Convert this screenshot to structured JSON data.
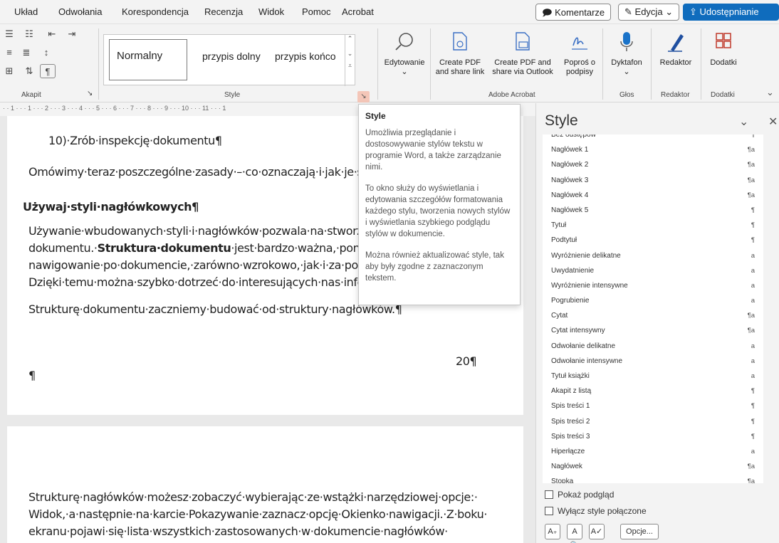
{
  "menu": {
    "items": [
      "Układ",
      "Odwołania",
      "Korespondencja",
      "Recenzja",
      "Widok",
      "Pomoc",
      "Acrobat"
    ],
    "comments_label": "Komentarze",
    "edit_label": "Edycja",
    "share_label": "Udostępnianie"
  },
  "ribbon": {
    "paragraph_group": "Akapit",
    "styles_group": "Style",
    "gallery": [
      "Normalny",
      "przypis dolny",
      "przypis końco"
    ],
    "editing_label": "Edytowanie",
    "acrobat": {
      "create_pdf": [
        "Create PDF",
        "and share link"
      ],
      "create_pdf_outlook": [
        "Create PDF and",
        "share via Outlook"
      ],
      "request_sign": [
        "Poproś o",
        "podpisy"
      ],
      "group": "Adobe Acrobat"
    },
    "dictate_label": "Dyktafon",
    "voice_group": "Głos",
    "editor_label": "Redaktor",
    "editor_group": "Redaktor",
    "addins_label": "Dodatki",
    "addins_group": "Dodatki"
  },
  "ruler": "· · 1 · · · 1 · · · 2 · · · 3 · · · 4 · · · 5 · · · 6 · · · 7 · · · 8 · · · 9 · · · 10 · · · 11 · · · 1",
  "document": {
    "line1": "10)·Zrób·inspekcję·dokumentu¶",
    "line2": "Omówimy·teraz·poszczególne·zasady·–·co·oznaczają·i·jak·je·spe",
    "heading": "Używaj·styli·nagłówkowych¶",
    "para1_l1": "Używanie·wbudowanych·styli·i·nagłówków·pozwala·na·stworzen",
    "para1_l2_pre": "dokumentu.·",
    "para1_l2_bold": "Struktura·dokumentu",
    "para1_l2_post": "·jest·bardzo·ważna,·poniew",
    "para1_l3": "nawigowanie·po·dokumencie,·zarówno·wzrokowo,·jak·i·za·pomo",
    "para1_l4": "Dzięki·temu·można·szybko·dotrzeć·do·interesujących·nas·inform",
    "para2": "Strukturę·dokumentu·zaczniemy·budować·od·struktury·nagłówków.¶",
    "page_number": "20¶",
    "empty_para": "¶",
    "page2_l1": "Strukturę·nagłówków·możesz·zobaczyć·wybierając·ze·wstążki·narzędziowej·opcje:·",
    "page2_l2": "Widok,·a·następnie·na·karcie·Pokazywanie·zaznacz·opcję·Okienko·nawigacji.·Z·boku·",
    "page2_l3": "ekranu·pojawi·się·lista·wszystkich·zastosowanych·w·dokumencie·nagłówków·"
  },
  "tooltip": {
    "title": "Style",
    "p1": "Umożliwia przeglądanie i dostosowywanie stylów tekstu w programie Word, a także zarządzanie nimi.",
    "p2": "To okno służy do wyświetlania i edytowania szczegółów formatowania każdego stylu, tworzenia nowych stylów i wyświetlania szybkiego podglądu stylów w dokumencie.",
    "p3": "Można również aktualizować style, tak aby były zgodne z zaznaczonym tekstem."
  },
  "styles_pane": {
    "title": "Style",
    "items": [
      {
        "name": "Bez odstępów",
        "mark": "¶"
      },
      {
        "name": "Nagłówek 1",
        "mark": "¶a"
      },
      {
        "name": "Nagłówek 2",
        "mark": "¶a"
      },
      {
        "name": "Nagłówek 3",
        "mark": "¶a"
      },
      {
        "name": "Nagłówek 4",
        "mark": "¶a"
      },
      {
        "name": "Nagłówek 5",
        "mark": "¶"
      },
      {
        "name": "Tytuł",
        "mark": "¶"
      },
      {
        "name": "Podtytuł",
        "mark": "¶"
      },
      {
        "name": "Wyróżnienie delikatne",
        "mark": "a"
      },
      {
        "name": "Uwydatnienie",
        "mark": "a"
      },
      {
        "name": "Wyróżnienie intensywne",
        "mark": "a"
      },
      {
        "name": "Pogrubienie",
        "mark": "a"
      },
      {
        "name": "Cytat",
        "mark": "¶a"
      },
      {
        "name": "Cytat intensywny",
        "mark": "¶a"
      },
      {
        "name": "Odwołanie delikatne",
        "mark": "a"
      },
      {
        "name": "Odwołanie intensywne",
        "mark": "a"
      },
      {
        "name": "Tytuł książki",
        "mark": "a"
      },
      {
        "name": "Akapit z listą",
        "mark": "¶"
      },
      {
        "name": "Spis treści 1",
        "mark": "¶"
      },
      {
        "name": "Spis treści 2",
        "mark": "¶"
      },
      {
        "name": "Spis treści 3",
        "mark": "¶"
      },
      {
        "name": "Hiperłącze",
        "mark": "a"
      },
      {
        "name": "Nagłówek",
        "mark": "¶a"
      },
      {
        "name": "Stopka",
        "mark": "¶a"
      }
    ],
    "show_preview": "Pokaż podgląd",
    "disable_linked": "Wyłącz style połączone",
    "options_label": "Opcje..."
  }
}
